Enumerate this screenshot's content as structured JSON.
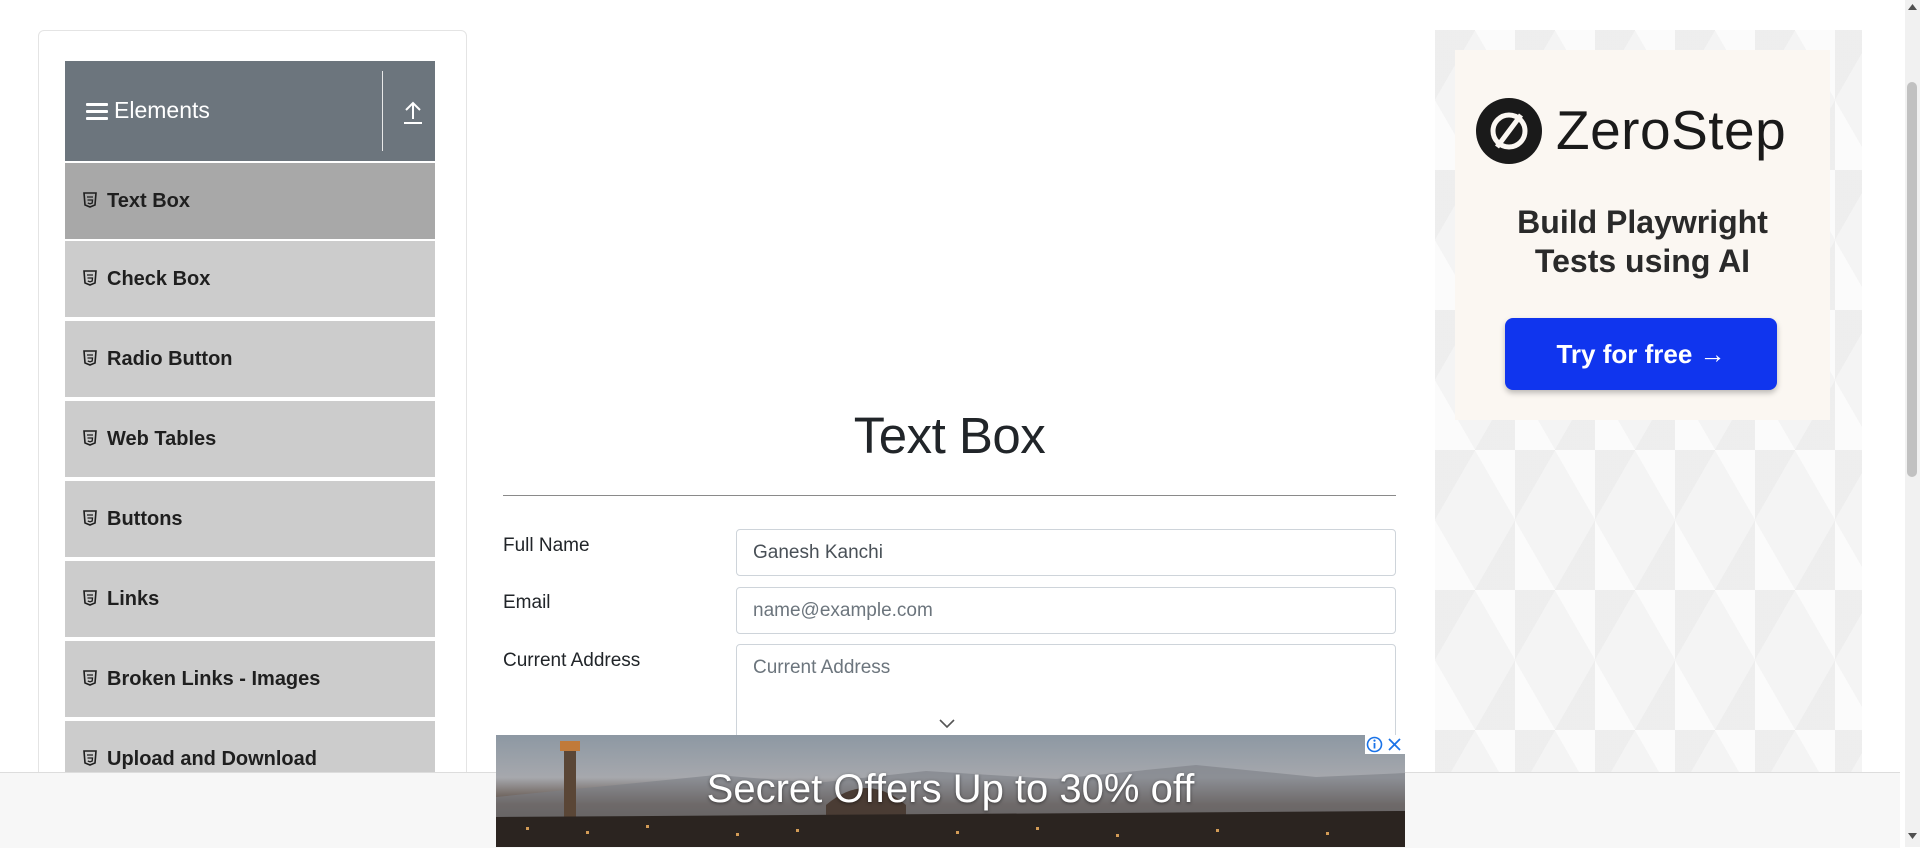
{
  "sidebar": {
    "group_title": "Elements",
    "items": [
      {
        "label": "Text Box",
        "active": true
      },
      {
        "label": "Check Box"
      },
      {
        "label": "Radio Button"
      },
      {
        "label": "Web Tables"
      },
      {
        "label": "Buttons"
      },
      {
        "label": "Links"
      },
      {
        "label": "Broken Links - Images"
      },
      {
        "label": "Upload and Download"
      }
    ]
  },
  "main": {
    "title": "Text Box",
    "form": {
      "full_name_label": "Full Name",
      "full_name_value": "Ganesh Kanchi",
      "email_label": "Email",
      "email_placeholder": "name@example.com",
      "address_label": "Current Address",
      "address_placeholder": "Current Address"
    }
  },
  "ad_right": {
    "brand": "ZeroStep",
    "tagline_line1": "Build Playwright",
    "tagline_line2": "Tests using AI",
    "cta": "Try for free →",
    "cta_color": "#1035ee"
  },
  "ad_bottom": {
    "text": "Secret Offers Up to 30% off"
  },
  "colors": {
    "sidebar_header": "#6c757d",
    "menu_item": "#cccccc",
    "menu_item_active": "#a8a8a8"
  }
}
